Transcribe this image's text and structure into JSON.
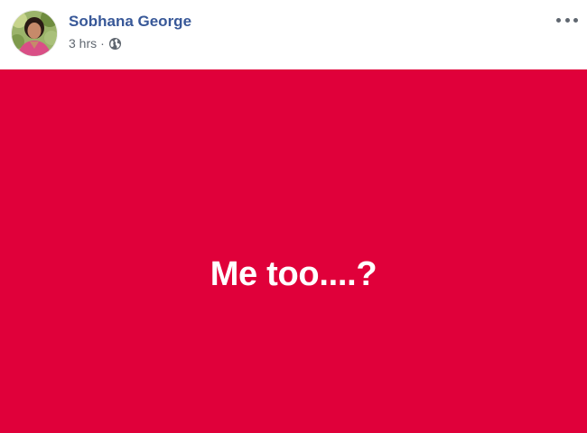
{
  "post": {
    "author_name": "Sobhana George",
    "timestamp": "3 hrs",
    "separator": "·",
    "privacy_icon": "globe-icon",
    "more_icon": "more-options-icon",
    "text": "Me too....?",
    "background_color": "#e0003a",
    "text_color": "#ffffff",
    "name_color": "#385898"
  }
}
